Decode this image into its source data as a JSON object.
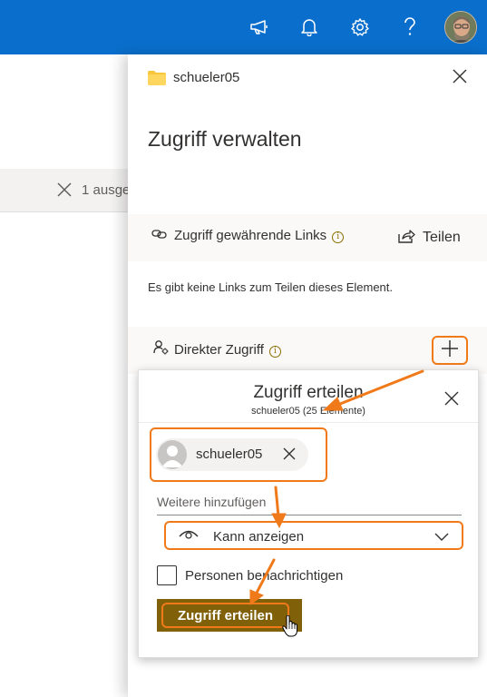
{
  "background": {
    "toolbar_text": "1 ausge"
  },
  "panel": {
    "folder_name": "schueler05",
    "title": "Zugriff verwalten",
    "links_section": {
      "label": "Zugriff gewährende Links",
      "share_label": "Teilen"
    },
    "no_links_text": "Es gibt keine Links zum Teilen dieses Element.",
    "direct_access_label": "Direkter Zugriff"
  },
  "dialog": {
    "title": "Zugriff erteilen",
    "subtitle": "schueler05 (25 Elemente)",
    "person_chip": "schueler05",
    "add_more_placeholder": "Weitere hinzufügen",
    "permission": "Kann anzeigen",
    "notify_label": "Personen benachrichtigen",
    "grant_button": "Zugriff erteilen"
  },
  "colors": {
    "topbar": "#0a6fcc",
    "highlight": "#f07a1a",
    "grant_button_bg": "#806009"
  },
  "icons": [
    "megaphone-icon",
    "bell-icon",
    "gear-icon",
    "help-icon",
    "folder-icon",
    "close-icon",
    "link-icon",
    "info-icon",
    "share-icon",
    "people-settings-icon",
    "plus-icon",
    "person-icon",
    "eye-icon",
    "chevron-down-icon",
    "hand-cursor-icon"
  ]
}
